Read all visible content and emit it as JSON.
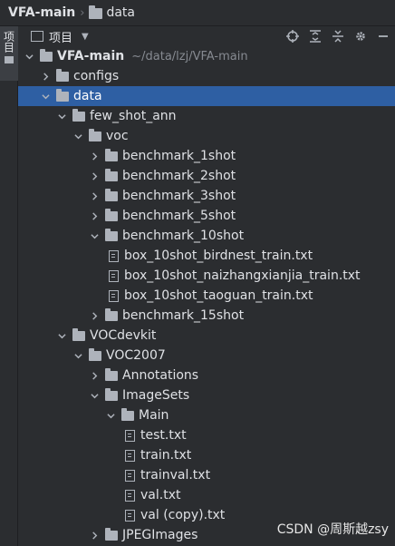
{
  "breadcrumb": {
    "project": "VFA-main",
    "folder": "data"
  },
  "side_tab": {
    "label": "项目"
  },
  "panel": {
    "title": "项目"
  },
  "tree": [
    {
      "label": "VFA-main",
      "path": "~/data/lzj/VFA-main",
      "depth": 0,
      "type": "folder",
      "expanded": true,
      "bold": true
    },
    {
      "label": "configs",
      "depth": 1,
      "type": "folder",
      "expanded": false
    },
    {
      "label": "data",
      "depth": 1,
      "type": "folder",
      "expanded": true,
      "selected": true
    },
    {
      "label": "few_shot_ann",
      "depth": 2,
      "type": "folder",
      "expanded": true
    },
    {
      "label": "voc",
      "depth": 3,
      "type": "folder",
      "expanded": true
    },
    {
      "label": "benchmark_1shot",
      "depth": 4,
      "type": "folder",
      "expanded": false
    },
    {
      "label": "benchmark_2shot",
      "depth": 4,
      "type": "folder",
      "expanded": false
    },
    {
      "label": "benchmark_3shot",
      "depth": 4,
      "type": "folder",
      "expanded": false
    },
    {
      "label": "benchmark_5shot",
      "depth": 4,
      "type": "folder",
      "expanded": false
    },
    {
      "label": "benchmark_10shot",
      "depth": 4,
      "type": "folder",
      "expanded": true
    },
    {
      "label": "box_10shot_birdnest_train.txt",
      "depth": 5,
      "type": "file"
    },
    {
      "label": "box_10shot_naizhangxianjia_train.txt",
      "depth": 5,
      "type": "file"
    },
    {
      "label": "box_10shot_taoguan_train.txt",
      "depth": 5,
      "type": "file"
    },
    {
      "label": "benchmark_15shot",
      "depth": 4,
      "type": "folder",
      "expanded": false
    },
    {
      "label": "VOCdevkit",
      "depth": 2,
      "type": "folder",
      "expanded": true
    },
    {
      "label": "VOC2007",
      "depth": 3,
      "type": "folder",
      "expanded": true
    },
    {
      "label": "Annotations",
      "depth": 4,
      "type": "folder",
      "expanded": false
    },
    {
      "label": "ImageSets",
      "depth": 4,
      "type": "folder",
      "expanded": true
    },
    {
      "label": "Main",
      "depth": 5,
      "type": "folder",
      "expanded": true
    },
    {
      "label": "test.txt",
      "depth": 6,
      "type": "file"
    },
    {
      "label": "train.txt",
      "depth": 6,
      "type": "file"
    },
    {
      "label": "trainval.txt",
      "depth": 6,
      "type": "file"
    },
    {
      "label": "val.txt",
      "depth": 6,
      "type": "file"
    },
    {
      "label": "val (copy).txt",
      "depth": 6,
      "type": "file"
    },
    {
      "label": "JPEGImages",
      "depth": 4,
      "type": "folder",
      "expanded": false
    }
  ],
  "watermark": "CSDN @周斯越zsy",
  "colors": {
    "background": "#2b2d30",
    "selection": "#2e5fa3",
    "text": "#dfe1e5",
    "icon": "#aeb3bb"
  }
}
